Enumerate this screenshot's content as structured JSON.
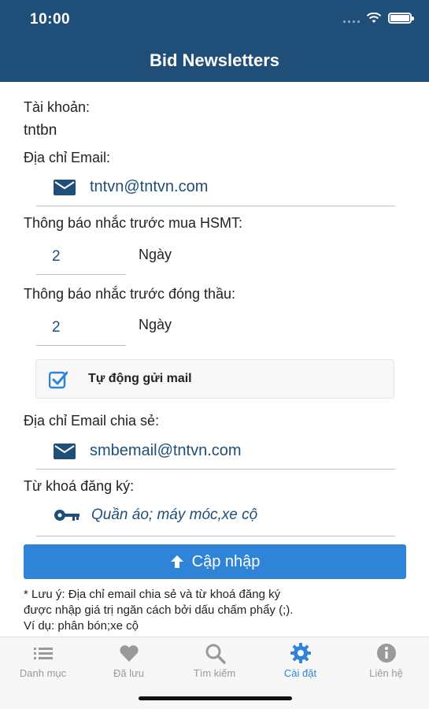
{
  "status_bar": {
    "time": "10:00"
  },
  "header": {
    "title": "Bid Newsletters"
  },
  "account": {
    "label": "Tài khoản:",
    "value": "tntbn"
  },
  "email": {
    "label": "Địa chỉ Email:",
    "value": "tntvn@tntvn.com",
    "icon": "envelope-icon"
  },
  "reminder_purchase": {
    "label": "Thông báo nhắc trước mua HSMT:",
    "value": "2",
    "unit": "Ngày"
  },
  "reminder_close": {
    "label": "Thông báo nhắc trước đóng thầu:",
    "value": "2",
    "unit": "Ngày"
  },
  "auto_send": {
    "label": "Tự động gửi mail",
    "checked": true
  },
  "share_email": {
    "label": "Địa chỉ Email chia sẻ:",
    "value": "smbemail@tntvn.com",
    "icon": "envelope-icon"
  },
  "keywords": {
    "label": "Từ khoá đăng ký:",
    "value": "Quần áo; máy móc,xe cộ",
    "icon": "key-icon"
  },
  "update_button": {
    "label": "Cập nhập",
    "icon": "arrow-up-icon"
  },
  "note": {
    "line1": "* Lưu ý: Địa chỉ email chia sẻ và từ khoá đăng ký",
    "line2": "được nhập giá trị ngăn cách bởi dấu chấm phẩy (;).",
    "line3": "Ví dụ: phân bón;xe cộ"
  },
  "tabs": [
    {
      "label": "Danh mục",
      "icon": "list-icon",
      "active": false
    },
    {
      "label": "Đã lưu",
      "icon": "heart-icon",
      "active": false
    },
    {
      "label": "Tìm kiếm",
      "icon": "search-icon",
      "active": false
    },
    {
      "label": "Cài đặt",
      "icon": "gear-icon",
      "active": true
    },
    {
      "label": "Liên hệ",
      "icon": "info-icon",
      "active": false
    }
  ],
  "colors": {
    "header": "#1f4e79",
    "accent": "#2f84d8",
    "text_value": "#1f4e79",
    "tab_inactive": "#9a9a9a"
  }
}
